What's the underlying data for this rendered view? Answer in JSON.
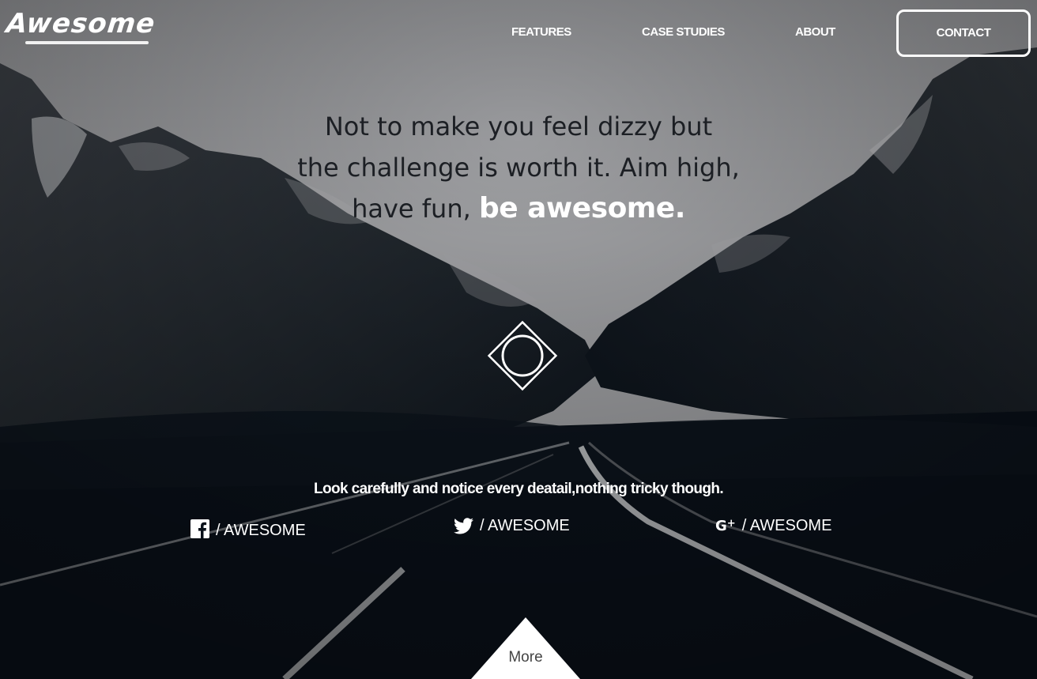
{
  "logo": {
    "text": "Awesome"
  },
  "nav": {
    "items": [
      {
        "label": "FEATURES"
      },
      {
        "label": "CASE STUDIES"
      },
      {
        "label": "ABOUT"
      }
    ],
    "contact_label": "CONTACT"
  },
  "hero": {
    "line1": "Not to make you feel dizzy but",
    "line2": "the challenge is worth it. Aim high,",
    "line3_plain": "have fun,",
    "line3_emphasis": "be awesome."
  },
  "tagline": "Look carefully and notice every deatail,nothing tricky though.",
  "social": [
    {
      "icon": "facebook-icon",
      "label": "/ AWESOME"
    },
    {
      "icon": "twitter-icon",
      "label": "/ AWESOME"
    },
    {
      "icon": "google-plus-icon",
      "label": "/ AWESOME"
    }
  ],
  "more_label": "More",
  "colors": {
    "text_light": "#ffffff",
    "text_dark": "#1c1f24",
    "bg_dark": "#0a111a"
  }
}
